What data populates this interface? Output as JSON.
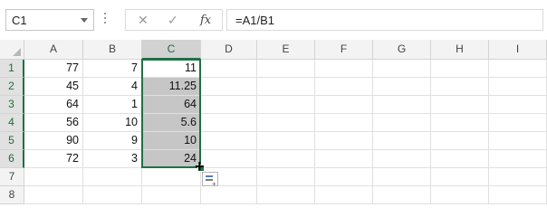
{
  "name_box": {
    "value": "C1"
  },
  "formula_bar": {
    "cancel_glyph": "✕",
    "enter_glyph": "✓",
    "fx_label": "fx",
    "formula": "=A1/B1"
  },
  "columns": [
    "A",
    "B",
    "C",
    "D",
    "E",
    "F",
    "G",
    "H",
    "I"
  ],
  "rows": [
    "1",
    "2",
    "3",
    "4",
    "5",
    "6",
    "7",
    "8"
  ],
  "cells": {
    "A": [
      "77",
      "45",
      "64",
      "56",
      "90",
      "72",
      "",
      ""
    ],
    "B": [
      "7",
      "4",
      "1",
      "10",
      "9",
      "3",
      "",
      ""
    ],
    "C": [
      "11",
      "11.25",
      "64",
      "5.6",
      "10",
      "24",
      "",
      ""
    ]
  },
  "selection": {
    "range": "C1:C6",
    "active_cell": "C1"
  },
  "colors": {
    "accent": "#1e7145",
    "selected_fill": "#c6c6c6",
    "header_bg": "#f3f3f3"
  },
  "icons": [
    "dropdown-arrow-icon",
    "cancel-icon",
    "enter-icon",
    "insert-function-icon",
    "fill-handle-cursor-icon",
    "quick-analysis-icon"
  ]
}
